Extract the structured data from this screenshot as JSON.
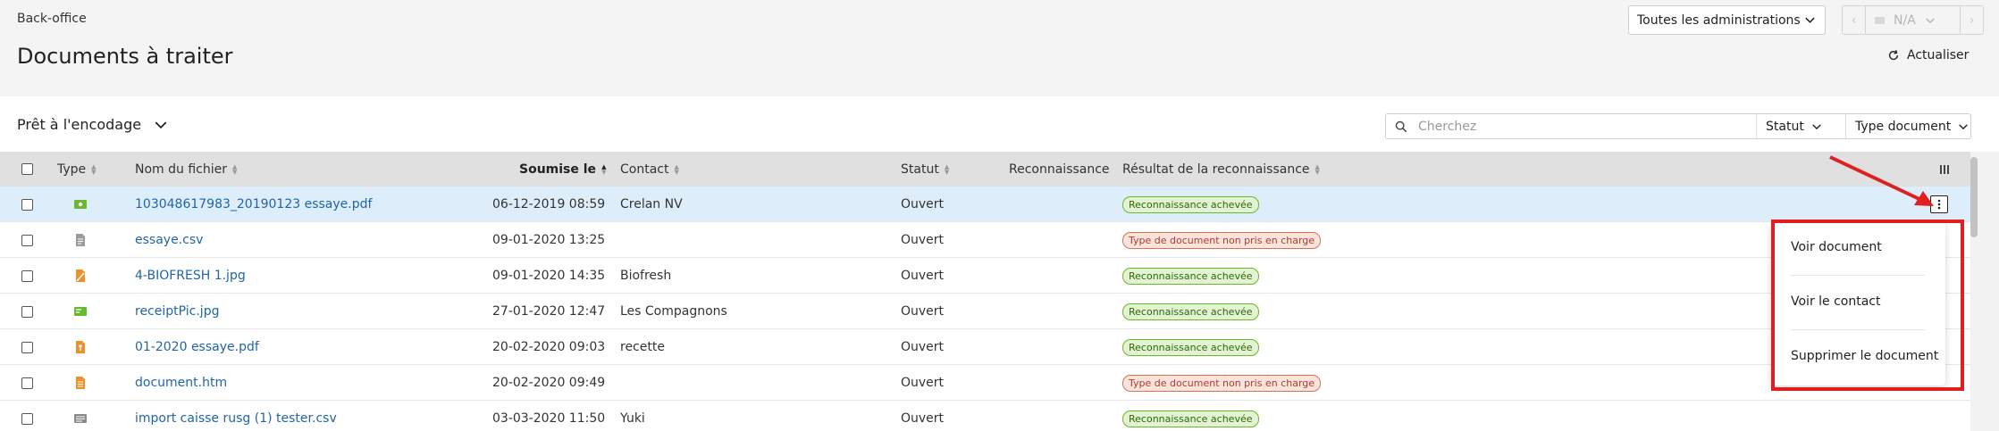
{
  "header": {
    "breadcrumb": "Back-office",
    "title": "Documents à traiter",
    "admin_select": "Toutes les administrations",
    "pager_value": "N/A",
    "refresh_label": "Actualiser"
  },
  "toolbar": {
    "view_title": "Prêt à l'encodage",
    "search_placeholder": "Cherchez",
    "filter_statut": "Statut",
    "filter_type": "Type document"
  },
  "table": {
    "columns": {
      "type": "Type",
      "filename": "Nom du fichier",
      "submitted": "Soumise le",
      "contact": "Contact",
      "status": "Statut",
      "recognition": "Reconnaissance",
      "result": "Résultat de la reconnaissance"
    },
    "rows": [
      {
        "icon": "money-icon",
        "icon_color": "#6ab82e",
        "filename": "103048617983_20190123 essaye.pdf",
        "date": "06-12-2019 08:59",
        "contact": "Crelan NV",
        "status": "Ouvert",
        "result": "Reconnaissance achevée",
        "result_kind": "ok"
      },
      {
        "icon": "file-icon",
        "icon_color": "#9b9b9b",
        "filename": "essaye.csv",
        "date": "09-01-2020 13:25",
        "contact": "",
        "status": "Ouvert",
        "result": "Type de document non pris en charge",
        "result_kind": "err"
      },
      {
        "icon": "edit-file-icon",
        "icon_color": "#f0902a",
        "filename": "4-BIOFRESH 1.jpg",
        "date": "09-01-2020 14:35",
        "contact": "Biofresh",
        "status": "Ouvert",
        "result": "Reconnaissance achevée",
        "result_kind": "ok"
      },
      {
        "icon": "receipt-icon",
        "icon_color": "#6ab82e",
        "filename": "receiptPic.jpg",
        "date": "27-01-2020 12:47",
        "contact": "Les Compagnons",
        "status": "Ouvert",
        "result": "Reconnaissance achevée",
        "result_kind": "ok"
      },
      {
        "icon": "invoice-icon",
        "icon_color": "#f0902a",
        "filename": "01-2020 essaye.pdf",
        "date": "20-02-2020 09:03",
        "contact": "recette",
        "status": "Ouvert",
        "result": "Reconnaissance achevée",
        "result_kind": "ok"
      },
      {
        "icon": "document-icon",
        "icon_color": "#f0902a",
        "filename": "document.htm",
        "date": "20-02-2020 09:49",
        "contact": "",
        "status": "Ouvert",
        "result": "Type de document non pris en charge",
        "result_kind": "err"
      },
      {
        "icon": "register-icon",
        "icon_color": "#8a8a8a",
        "filename": "import caisse rusg (1) tester.csv",
        "date": "03-03-2020 11:50",
        "contact": "Yuki",
        "status": "Ouvert",
        "result": "Reconnaissance achevée",
        "result_kind": "ok"
      }
    ]
  },
  "menu": {
    "items": [
      "Voir document",
      "Voir le contact",
      "Supprimer le document"
    ]
  },
  "colors": {
    "accent_red": "#e02020",
    "link_blue": "#2165a7",
    "selected_row": "#ddeefa"
  }
}
